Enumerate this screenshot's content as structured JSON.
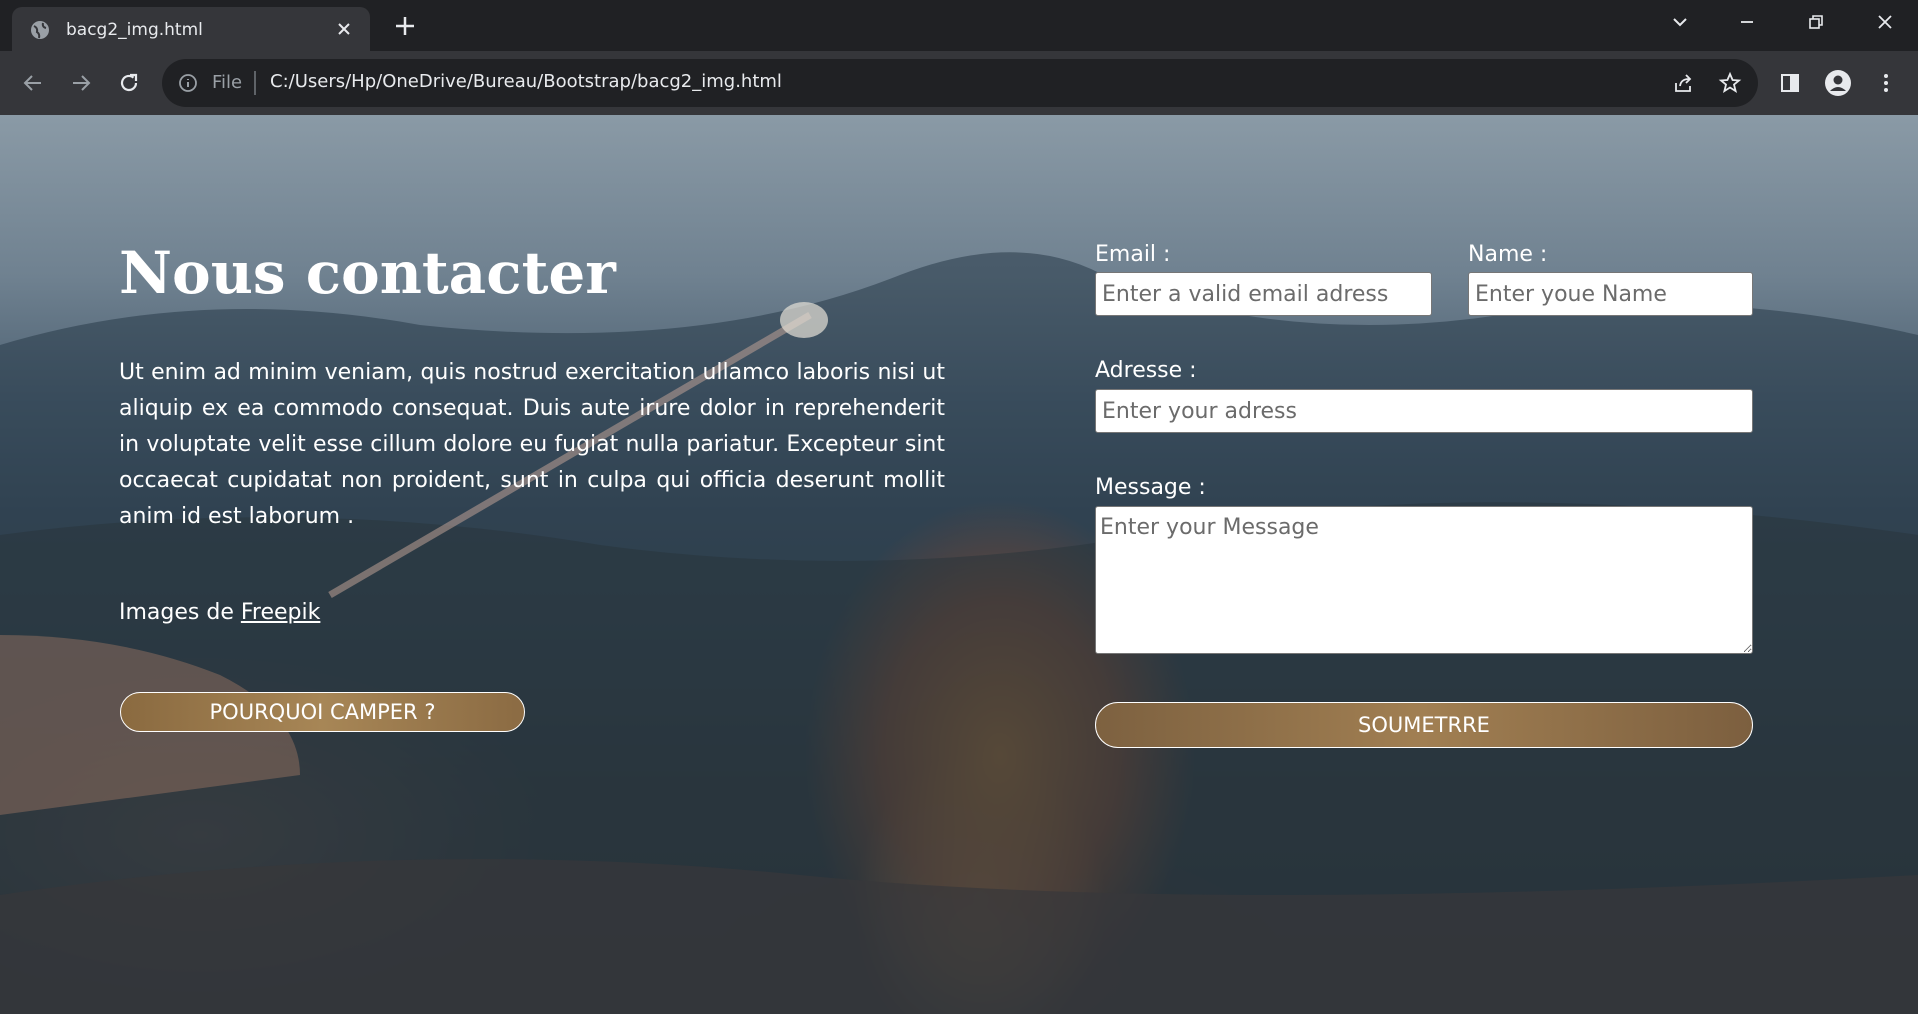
{
  "browser": {
    "tab_title": "bacg2_img.html",
    "url_scheme": "File",
    "url": "C:/Users/Hp/OneDrive/Bureau/Bootstrap/bacg2_img.html"
  },
  "page": {
    "title": "Nous contacter",
    "intro": "Ut enim ad minim veniam, quis nostrud exercitation ullamco laboris nisi ut aliquip ex ea commodo consequat. Duis aute irure dolor in reprehenderit in voluptate velit esse cillum dolore eu fugiat nulla pariatur. Excepteur sint occaecat cupidatat non proident, sunt in culpa qui officia deserunt mollit anim id est laborum .",
    "credit_prefix": "Images de",
    "credit_link": "Freepik",
    "why_button": "POURQUOI CAMPER ?"
  },
  "form": {
    "email_label": "Email :",
    "email_placeholder": "Enter a valid email adress",
    "name_label": "Name :",
    "name_placeholder": "Enter youe Name",
    "address_label": "Adresse :",
    "address_placeholder": "Enter your adress",
    "message_label": "Message :",
    "message_placeholder": "Enter your Message",
    "submit_label": "SOUMETRRE"
  }
}
